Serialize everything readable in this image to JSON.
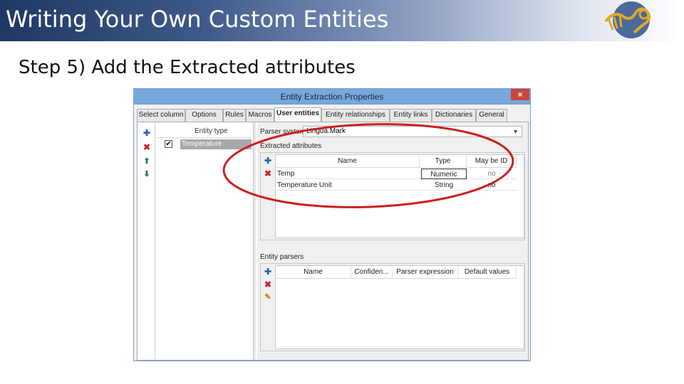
{
  "slide": {
    "title": "Writing Your Own Custom Entities",
    "step": "Step 5) Add the Extracted attributes"
  },
  "dialog": {
    "title": "Entity Extraction Properties",
    "close": "×",
    "tabs": [
      {
        "label": "Select column"
      },
      {
        "label": "Options"
      },
      {
        "label": "Rules"
      },
      {
        "label": "Macros"
      },
      {
        "label": "User entities",
        "active": true
      },
      {
        "label": "Entity relationships"
      },
      {
        "label": "Entity links"
      },
      {
        "label": "Dictionaries"
      },
      {
        "label": "General"
      }
    ],
    "left_panel": {
      "header": "Entity type",
      "entities": [
        {
          "name": "Temperature",
          "checked": true,
          "check_glyph": "✔"
        }
      ],
      "toolbar_icons": [
        "add-icon",
        "delete-icon",
        "move-up-icon",
        "move-down-icon"
      ]
    },
    "right_panel": {
      "parser_label": "Parser system",
      "parser_value": "Lingua.Mark",
      "extracted_label": "Extracted attributes",
      "attr_columns": [
        "Name",
        "Type",
        "May be ID"
      ],
      "attributes": [
        {
          "name": "Temp",
          "type": "Numeric",
          "may_be_id": "no"
        },
        {
          "name": "Temperature Unit",
          "type": "String",
          "may_be_id": "no"
        }
      ],
      "parsers_label": "Entity parsers",
      "parser_columns": [
        "Name",
        "Confiden...",
        "Parser expression",
        "Default values"
      ]
    }
  },
  "colors": {
    "header_dark": "#1f3864",
    "titlebar": "#77a7dd",
    "annotation": "#cc1f1f",
    "selection": "#a9a9a9"
  }
}
